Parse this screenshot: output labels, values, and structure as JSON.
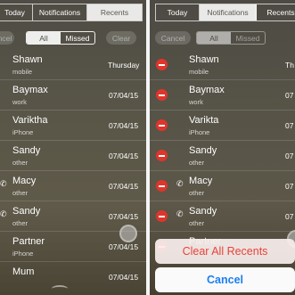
{
  "left": {
    "tabs": [
      "Today",
      "Notifications",
      "Recents"
    ],
    "selected_tab": "Recents",
    "edit_label": "Cancel",
    "filter": [
      "All",
      "Missed"
    ],
    "selected_filter": "All",
    "clear_label": "Clear",
    "calls": [
      {
        "name": "Shawn",
        "type": "mobile",
        "date": "Thursday",
        "outgoing": false
      },
      {
        "name": "Baymax",
        "type": "work",
        "date": "07/04/15",
        "outgoing": false
      },
      {
        "name": "Variktha",
        "type": "iPhone",
        "date": "07/04/15",
        "outgoing": false
      },
      {
        "name": "Sandy",
        "type": "other",
        "date": "07/04/15",
        "outgoing": false
      },
      {
        "name": "Macy",
        "type": "other",
        "date": "07/04/15",
        "outgoing": true
      },
      {
        "name": "Sandy",
        "type": "other",
        "date": "07/04/15",
        "outgoing": true
      },
      {
        "name": "Partner",
        "type": "iPhone",
        "date": "07/04/15",
        "outgoing": false
      },
      {
        "name": "Mum",
        "type": "",
        "date": "07/04/15",
        "outgoing": false
      }
    ]
  },
  "right": {
    "tabs": [
      "Today",
      "Notifications",
      "Recents"
    ],
    "selected_tab": "Notifications",
    "edit_label": "Cancel",
    "filter": [
      "All",
      "Missed"
    ],
    "selected_filter": "All",
    "calls": [
      {
        "name": "Shawn",
        "type": "mobile",
        "date": "Th",
        "outgoing": false
      },
      {
        "name": "Baymax",
        "type": "work",
        "date": "07",
        "outgoing": false
      },
      {
        "name": "Varikta",
        "type": "iPhone",
        "date": "07",
        "outgoing": false
      },
      {
        "name": "Sandy",
        "type": "other",
        "date": "07",
        "outgoing": false
      },
      {
        "name": "Macy",
        "type": "other",
        "date": "07",
        "outgoing": true
      },
      {
        "name": "Sandy",
        "type": "other",
        "date": "07",
        "outgoing": true
      },
      {
        "name": "Partner",
        "type": "",
        "date": "",
        "outgoing": false
      }
    ],
    "action_sheet": {
      "clear_all_label": "Clear All Recents",
      "cancel_label": "Cancel"
    }
  },
  "icons": {
    "outgoing_call": "phone-icon",
    "delete": "minus-circle-icon",
    "home": "home-indicator-icon",
    "assistive_touch": "assistive-touch-icon"
  },
  "colors": {
    "delete_red": "#e0352b",
    "destructive_text": "#e8433a",
    "cancel_blue": "#1a7ff2"
  }
}
